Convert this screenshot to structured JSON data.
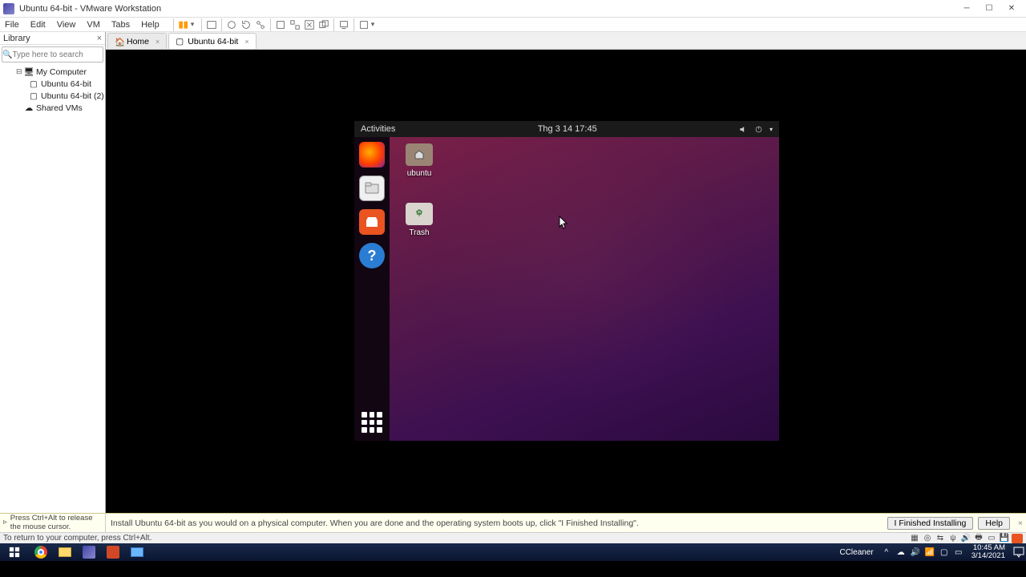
{
  "titlebar": {
    "text": "Ubuntu 64-bit - VMware Workstation"
  },
  "menu": {
    "file": "File",
    "edit": "Edit",
    "view": "View",
    "vm": "VM",
    "tabs": "Tabs",
    "help": "Help"
  },
  "library": {
    "title": "Library",
    "search_placeholder": "Type here to search",
    "nodes": {
      "root": "My Computer",
      "vm1": "Ubuntu 64-bit",
      "vm2": "Ubuntu 64-bit (2)",
      "shared": "Shared VMs"
    }
  },
  "tabs": {
    "home": "Home",
    "vm": "Ubuntu 64-bit"
  },
  "ubuntu": {
    "activities": "Activities",
    "date": "Thg 3 14  17:45",
    "desk": {
      "home": "ubuntu",
      "trash": "Trash"
    }
  },
  "hint": {
    "left": "Press Ctrl+Alt to release the mouse cursor.",
    "mid": "Install Ubuntu 64-bit as you would on a physical computer. When you are done and the operating system boots up, click \"I Finished Installing\".",
    "finish": "I Finished Installing",
    "help": "Help"
  },
  "status": {
    "left": "To return to your computer, press Ctrl+Alt."
  },
  "win": {
    "ccleaner": "CCleaner",
    "time": "10:45 AM",
    "date": "3/14/2021"
  }
}
